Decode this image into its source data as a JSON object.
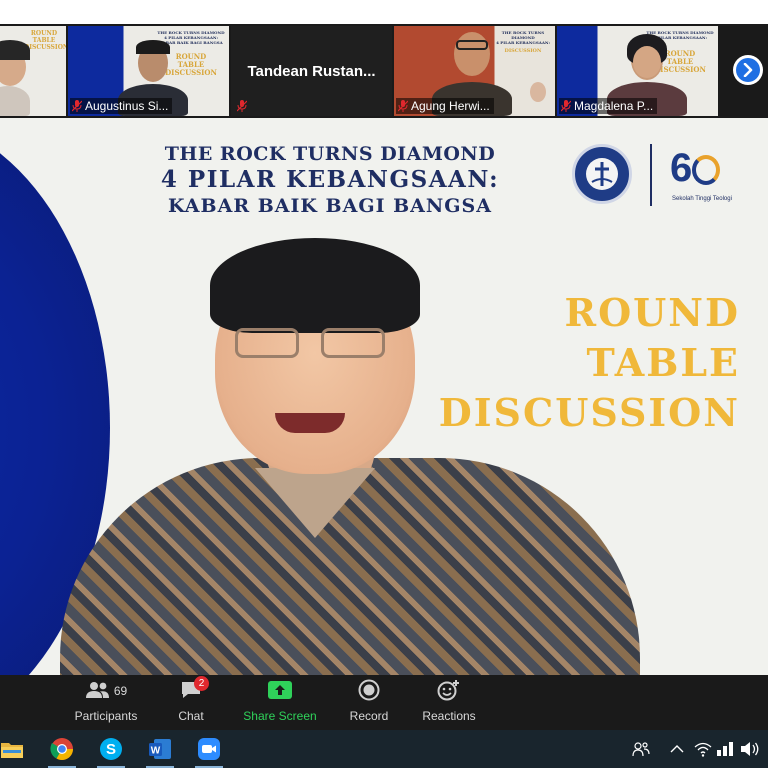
{
  "gallery": {
    "tiles": [
      {
        "name": "",
        "muted": false
      },
      {
        "name": "Augustinus Si...",
        "muted": true
      },
      {
        "name": "Tandean  Rustan...",
        "muted": true
      },
      {
        "name": "Agung Herwi...",
        "muted": true
      },
      {
        "name": "Magdalena P...",
        "muted": true
      }
    ],
    "poster_small": {
      "line1": "THE ROCK TURNS DIAMOND",
      "line2": "4 PILAR KEBANGSAAN:",
      "line3": "KABAR BAIK BAGI BANGSA",
      "rtd": [
        "ROUND",
        "TABLE",
        "DISCUSSION"
      ]
    }
  },
  "main_video": {
    "title_line1": "THE ROCK TURNS DIAMOND",
    "title_line2": "4 PILAR KEBANGSAAN:",
    "title_line3": "KABAR BAIK BAGI BANGSA",
    "logo_number": "6",
    "logo_tagline": "Sekolah Tinggi Teologi",
    "rtd_line1": "ROUND",
    "rtd_line2": "TABLE",
    "rtd_line3": "DISCUSSION"
  },
  "toolbar": {
    "participants_label": "Participants",
    "participants_count": "69",
    "chat_label": "Chat",
    "chat_badge": "2",
    "share_label": "Share Screen",
    "record_label": "Record",
    "reactions_label": "Reactions"
  },
  "colors": {
    "share_green": "#2fd15a",
    "zoom_blue": "#1f6fe3",
    "poster_gold": "#f0b83a",
    "poster_navy": "#1f2e63"
  },
  "taskbar": {
    "apps": [
      "file-explorer-icon",
      "chrome-icon",
      "skype-icon",
      "word-icon",
      "zoom-icon"
    ],
    "tray": [
      "people-icon",
      "chevron-up-icon",
      "wifi-icon",
      "network-icon",
      "volume-icon"
    ]
  }
}
